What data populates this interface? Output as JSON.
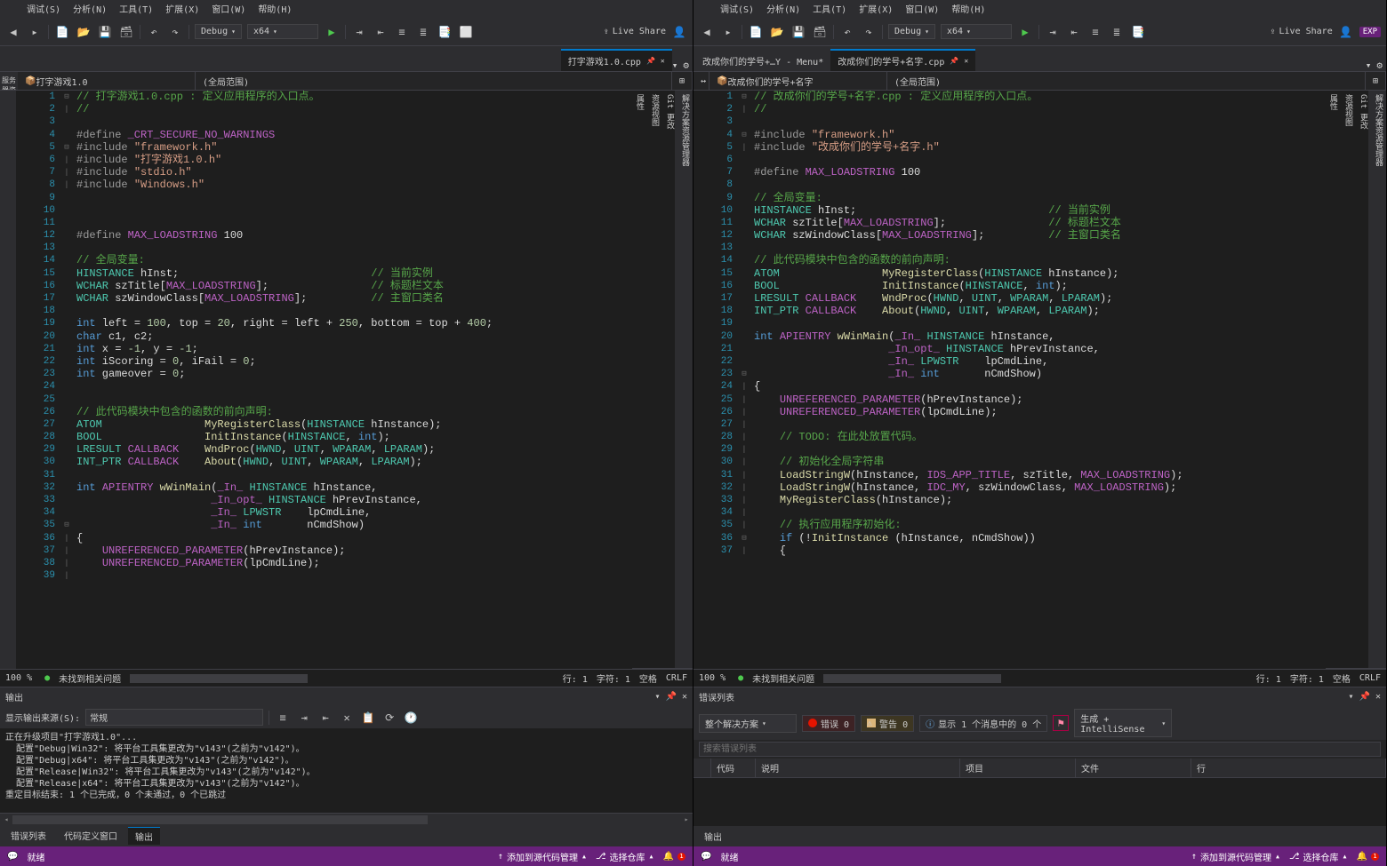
{
  "menu": [
    "调试(S)",
    "分析(N)",
    "工具(T)",
    "扩展(X)",
    "窗口(W)",
    "帮助(H)"
  ],
  "left": {
    "config": "Debug",
    "platform": "x64",
    "liveshare": "Live Share",
    "tab": "打字游戏1.0.cpp",
    "navScope1": "打字游戏1.0",
    "navScope2": "(全局范围)",
    "sideToolLeft": "服务器资源管理器 工具箱",
    "code": [
      {
        "n": 1,
        "f": "⊟",
        "html": "<span class='c-cm'>// 打字游戏1.0.cpp : 定义应用程序的入口点。</span>"
      },
      {
        "n": 2,
        "f": "|",
        "html": "<span class='c-cm'>//</span>"
      },
      {
        "n": 3,
        "f": "",
        "html": ""
      },
      {
        "n": 4,
        "f": "",
        "html": "<span class='c-pp'>#define </span><span class='c-mac'>_CRT_SECURE_NO_WARNINGS</span>"
      },
      {
        "n": 5,
        "f": "⊟",
        "html": "<span class='c-pp'>#include </span><span class='c-str'>\"framework.h\"</span>"
      },
      {
        "n": 6,
        "f": "|",
        "html": "<span class='c-pp'>#include </span><span class='c-str'>\"打字游戏1.0.h\"</span>"
      },
      {
        "n": 7,
        "f": "|",
        "html": "<span class='c-pp'>#include </span><span class='c-str'>\"stdio.h\"</span>"
      },
      {
        "n": 8,
        "f": "|",
        "html": "<span class='c-pp'>#include </span><span class='c-str'>\"Windows.h\"</span>"
      },
      {
        "n": 9,
        "f": "",
        "html": ""
      },
      {
        "n": 10,
        "f": "",
        "html": ""
      },
      {
        "n": 11,
        "f": "",
        "html": ""
      },
      {
        "n": 12,
        "f": "",
        "html": "<span class='c-pp'>#define </span><span class='c-mac'>MAX_LOADSTRING</span><span class='c-id'> 100</span>"
      },
      {
        "n": 13,
        "f": "",
        "html": ""
      },
      {
        "n": 14,
        "f": "",
        "html": "<span class='c-cm'>// 全局变量:</span>"
      },
      {
        "n": 15,
        "f": "",
        "html": "<span class='c-ty'>HINSTANCE</span><span class='c-id'> hInst;                              </span><span class='c-cm'>// 当前实例</span>"
      },
      {
        "n": 16,
        "f": "",
        "html": "<span class='c-ty'>WCHAR</span><span class='c-id'> szTitle[</span><span class='c-mac'>MAX_LOADSTRING</span><span class='c-id'>];                </span><span class='c-cm'>// 标题栏文本</span>"
      },
      {
        "n": 17,
        "f": "",
        "html": "<span class='c-ty'>WCHAR</span><span class='c-id'> szWindowClass[</span><span class='c-mac'>MAX_LOADSTRING</span><span class='c-id'>];          </span><span class='c-cm'>// 主窗口类名</span>"
      },
      {
        "n": 18,
        "f": "",
        "html": ""
      },
      {
        "n": 19,
        "f": "",
        "html": "<span class='c-kw'>int</span><span class='c-id'> left = </span><span class='c-num'>100</span><span class='c-id'>, top = </span><span class='c-num'>20</span><span class='c-id'>, right = left + </span><span class='c-num'>250</span><span class='c-id'>, bottom = top + </span><span class='c-num'>400</span><span class='c-id'>;</span>"
      },
      {
        "n": 20,
        "f": "",
        "html": "<span class='c-kw'>char</span><span class='c-id'> c1, c2;</span>"
      },
      {
        "n": 21,
        "f": "",
        "html": "<span class='c-kw'>int</span><span class='c-id'> x = </span><span class='c-num'>-1</span><span class='c-id'>, y = </span><span class='c-num'>-1</span><span class='c-id'>;</span>"
      },
      {
        "n": 22,
        "f": "",
        "html": "<span class='c-kw'>int</span><span class='c-id'> iScoring = </span><span class='c-num'>0</span><span class='c-id'>, iFail = </span><span class='c-num'>0</span><span class='c-id'>;</span>"
      },
      {
        "n": 23,
        "f": "",
        "html": "<span class='c-kw'>int</span><span class='c-id'> gameover = </span><span class='c-num'>0</span><span class='c-id'>;</span>"
      },
      {
        "n": 24,
        "f": "",
        "html": ""
      },
      {
        "n": 25,
        "f": "",
        "html": ""
      },
      {
        "n": 26,
        "f": "",
        "html": "<span class='c-cm'>// 此代码模块中包含的函数的前向声明:</span>"
      },
      {
        "n": 27,
        "f": "",
        "html": "<span class='c-ty'>ATOM</span><span class='c-id'>                </span><span class='c-fn'>MyRegisterClass</span><span class='c-id'>(</span><span class='c-ty'>HINSTANCE</span><span class='c-id'> hInstance);</span>"
      },
      {
        "n": 28,
        "f": "",
        "html": "<span class='c-ty'>BOOL</span><span class='c-id'>                </span><span class='c-fn'>InitInstance</span><span class='c-id'>(</span><span class='c-ty'>HINSTANCE</span><span class='c-id'>, </span><span class='c-kw'>int</span><span class='c-id'>);</span>"
      },
      {
        "n": 29,
        "f": "",
        "html": "<span class='c-ty'>LRESULT</span><span class='c-id'> </span><span class='c-mac'>CALLBACK</span><span class='c-id'>    </span><span class='c-fn'>WndProc</span><span class='c-id'>(</span><span class='c-ty'>HWND</span><span class='c-id'>, </span><span class='c-ty'>UINT</span><span class='c-id'>, </span><span class='c-ty'>WPARAM</span><span class='c-id'>, </span><span class='c-ty'>LPARAM</span><span class='c-id'>);</span>"
      },
      {
        "n": 30,
        "f": "",
        "html": "<span class='c-ty'>INT_PTR</span><span class='c-id'> </span><span class='c-mac'>CALLBACK</span><span class='c-id'>    </span><span class='c-fn'>About</span><span class='c-id'>(</span><span class='c-ty'>HWND</span><span class='c-id'>, </span><span class='c-ty'>UINT</span><span class='c-id'>, </span><span class='c-ty'>WPARAM</span><span class='c-id'>, </span><span class='c-ty'>LPARAM</span><span class='c-id'>);</span>"
      },
      {
        "n": 31,
        "f": "",
        "html": ""
      },
      {
        "n": 32,
        "f": "",
        "html": "<span class='c-kw'>int</span><span class='c-id'> </span><span class='c-mac'>APIENTRY</span><span class='c-id'> </span><span class='c-fn'>wWinMain</span><span class='c-id'>(</span><span class='c-mac'>_In_</span><span class='c-id'> </span><span class='c-ty'>HINSTANCE</span><span class='c-id'> hInstance,</span>"
      },
      {
        "n": 33,
        "f": "",
        "html": "<span class='c-id'>                     </span><span class='c-mac'>_In_opt_</span><span class='c-id'> </span><span class='c-ty'>HINSTANCE</span><span class='c-id'> hPrevInstance,</span>"
      },
      {
        "n": 34,
        "f": "",
        "html": "<span class='c-id'>                     </span><span class='c-mac'>_In_</span><span class='c-id'> </span><span class='c-ty'>LPWSTR</span><span class='c-id'>    lpCmdLine,</span>"
      },
      {
        "n": 35,
        "f": "⊟",
        "html": "<span class='c-id'>                     </span><span class='c-mac'>_In_</span><span class='c-id'> </span><span class='c-kw'>int</span><span class='c-id'>       nCmdShow)</span>"
      },
      {
        "n": 36,
        "f": "|",
        "html": "<span class='c-id'>{</span>"
      },
      {
        "n": 37,
        "f": "|",
        "html": "<span class='c-id'>    </span><span class='c-mac'>UNREFERENCED_PARAMETER</span><span class='c-id'>(hPrevInstance);</span>"
      },
      {
        "n": 38,
        "f": "|",
        "html": "<span class='c-id'>    </span><span class='c-mac'>UNREFERENCED_PARAMETER</span><span class='c-id'>(lpCmdLine);</span>"
      },
      {
        "n": 39,
        "f": "|",
        "html": ""
      }
    ],
    "zoom": "100 %",
    "noIssues": "未找到相关问题",
    "cursorLine": "行: 1",
    "cursorCol": "字符: 1",
    "insertMode": "空格",
    "crlf": "CRLF",
    "out": {
      "header": "输出",
      "srcLabel": "显示输出来源(S):",
      "srcVal": "常规",
      "lines": [
        "正在升级项目\"打字游戏1.0\"...",
        "  配置\"Debug|Win32\": 将平台工具集更改为\"v143\"(之前为\"v142\")。",
        "  配置\"Debug|x64\": 将平台工具集更改为\"v143\"(之前为\"v142\")。",
        "  配置\"Release|Win32\": 将平台工具集更改为\"v143\"(之前为\"v142\")。",
        "  配置\"Release|x64\": 将平台工具集更改为\"v143\"(之前为\"v142\")。",
        "重定目标结束: 1 个已完成，0 个未通过，0 个已跳过"
      ]
    },
    "bottomTabs": [
      "错误列表",
      "代码定义窗口",
      "输出"
    ],
    "bottomTabActive": 2,
    "status": {
      "ready": "就绪",
      "scm": "添加到源代码管理",
      "repo": "选择仓库",
      "errCount": "1"
    }
  },
  "right": {
    "config": "Debug",
    "platform": "x64",
    "liveshare": "Live Share",
    "exp": "EXP",
    "tab1": "改成你们的学号+…Y - Menu*",
    "tab2": "改成你们的学号+名字.cpp",
    "navScope1": "改成你们的学号+名字",
    "navScope2": "(全局范围)",
    "sidePanels": [
      "解决方案资源管理器",
      "Git 更改",
      "资源视图",
      "属性"
    ],
    "code": [
      {
        "n": 1,
        "f": "⊟",
        "html": "<span class='c-cm'>// 改成你们的学号+名字.cpp : 定义应用程序的入口点。</span>"
      },
      {
        "n": 2,
        "f": "|",
        "html": "<span class='c-cm'>//</span>"
      },
      {
        "n": 3,
        "f": "",
        "html": ""
      },
      {
        "n": 4,
        "f": "⊟",
        "html": "<span class='c-pp'>#include </span><span class='c-str'>\"framework.h\"</span>"
      },
      {
        "n": 5,
        "f": "|",
        "html": "<span class='c-pp'>#include </span><span class='c-str'>\"改成你们的学号+名字.h\"</span>"
      },
      {
        "n": 6,
        "f": "",
        "html": ""
      },
      {
        "n": 7,
        "f": "",
        "html": "<span class='c-pp'>#define </span><span class='c-mac'>MAX_LOADSTRING</span><span class='c-id'> 100</span>"
      },
      {
        "n": 8,
        "f": "",
        "html": ""
      },
      {
        "n": 9,
        "f": "",
        "html": "<span class='c-cm'>// 全局变量:</span>"
      },
      {
        "n": 10,
        "f": "",
        "html": "<span class='c-ty'>HINSTANCE</span><span class='c-id'> hInst;                              </span><span class='c-cm'>// 当前实例</span>"
      },
      {
        "n": 11,
        "f": "",
        "html": "<span class='c-ty'>WCHAR</span><span class='c-id'> szTitle[</span><span class='c-mac'>MAX_LOADSTRING</span><span class='c-id'>];                </span><span class='c-cm'>// 标题栏文本</span>"
      },
      {
        "n": 12,
        "f": "",
        "html": "<span class='c-ty'>WCHAR</span><span class='c-id'> szWindowClass[</span><span class='c-mac'>MAX_LOADSTRING</span><span class='c-id'>];          </span><span class='c-cm'>// 主窗口类名</span>"
      },
      {
        "n": 13,
        "f": "",
        "html": ""
      },
      {
        "n": 14,
        "f": "",
        "html": "<span class='c-cm'>// 此代码模块中包含的函数的前向声明:</span>"
      },
      {
        "n": 15,
        "f": "",
        "html": "<span class='c-ty'>ATOM</span><span class='c-id'>                </span><span class='c-fn'>MyRegisterClass</span><span class='c-id'>(</span><span class='c-ty'>HINSTANCE</span><span class='c-id'> hInstance);</span>"
      },
      {
        "n": 16,
        "f": "",
        "html": "<span class='c-ty'>BOOL</span><span class='c-id'>                </span><span class='c-fn'>InitInstance</span><span class='c-id'>(</span><span class='c-ty'>HINSTANCE</span><span class='c-id'>, </span><span class='c-kw'>int</span><span class='c-id'>);</span>"
      },
      {
        "n": 17,
        "f": "",
        "html": "<span class='c-ty'>LRESULT</span><span class='c-id'> </span><span class='c-mac'>CALLBACK</span><span class='c-id'>    </span><span class='c-fn'>WndProc</span><span class='c-id'>(</span><span class='c-ty'>HWND</span><span class='c-id'>, </span><span class='c-ty'>UINT</span><span class='c-id'>, </span><span class='c-ty'>WPARAM</span><span class='c-id'>, </span><span class='c-ty'>LPARAM</span><span class='c-id'>);</span>"
      },
      {
        "n": 18,
        "f": "",
        "html": "<span class='c-ty'>INT_PTR</span><span class='c-id'> </span><span class='c-mac'>CALLBACK</span><span class='c-id'>    </span><span class='c-fn'>About</span><span class='c-id'>(</span><span class='c-ty'>HWND</span><span class='c-id'>, </span><span class='c-ty'>UINT</span><span class='c-id'>, </span><span class='c-ty'>WPARAM</span><span class='c-id'>, </span><span class='c-ty'>LPARAM</span><span class='c-id'>);</span>"
      },
      {
        "n": 19,
        "f": "",
        "html": ""
      },
      {
        "n": 20,
        "f": "",
        "html": "<span class='c-kw'>int</span><span class='c-id'> </span><span class='c-mac'>APIENTRY</span><span class='c-id'> </span><span class='c-fn'>wWinMain</span><span class='c-id'>(</span><span class='c-mac'>_In_</span><span class='c-id'> </span><span class='c-ty'>HINSTANCE</span><span class='c-id'> hInstance,</span>"
      },
      {
        "n": 21,
        "f": "",
        "html": "<span class='c-id'>                     </span><span class='c-mac'>_In_opt_</span><span class='c-id'> </span><span class='c-ty'>HINSTANCE</span><span class='c-id'> hPrevInstance,</span>"
      },
      {
        "n": 22,
        "f": "",
        "html": "<span class='c-id'>                     </span><span class='c-mac'>_In_</span><span class='c-id'> </span><span class='c-ty'>LPWSTR</span><span class='c-id'>    lpCmdLine,</span>"
      },
      {
        "n": 23,
        "f": "⊟",
        "html": "<span class='c-id'>                     </span><span class='c-mac'>_In_</span><span class='c-id'> </span><span class='c-kw'>int</span><span class='c-id'>       nCmdShow)</span>"
      },
      {
        "n": 24,
        "f": "|",
        "html": "<span class='c-id'>{</span>"
      },
      {
        "n": 25,
        "f": "|",
        "html": "<span class='c-id'>    </span><span class='c-mac'>UNREFERENCED_PARAMETER</span><span class='c-id'>(hPrevInstance);</span>"
      },
      {
        "n": 26,
        "f": "|",
        "html": "<span class='c-id'>    </span><span class='c-mac'>UNREFERENCED_PARAMETER</span><span class='c-id'>(lpCmdLine);</span>"
      },
      {
        "n": 27,
        "f": "|",
        "html": ""
      },
      {
        "n": 28,
        "f": "|",
        "html": "<span class='c-id'>    </span><span class='c-cm'>// TODO: 在此处放置代码。</span>"
      },
      {
        "n": 29,
        "f": "|",
        "html": ""
      },
      {
        "n": 30,
        "f": "|",
        "html": "<span class='c-id'>    </span><span class='c-cm'>// 初始化全局字符串</span>"
      },
      {
        "n": 31,
        "f": "|",
        "html": "<span class='c-id'>    </span><span class='c-fn'>LoadStringW</span><span class='c-id'>(hInstance, </span><span class='c-mac'>IDS_APP_TITLE</span><span class='c-id'>, szTitle, </span><span class='c-mac'>MAX_LOADSTRING</span><span class='c-id'>);</span>"
      },
      {
        "n": 32,
        "f": "|",
        "html": "<span class='c-id'>    </span><span class='c-fn'>LoadStringW</span><span class='c-id'>(hInstance, </span><span class='c-mac'>IDC_MY</span><span class='c-id'>, szWindowClass, </span><span class='c-mac'>MAX_LOADSTRING</span><span class='c-id'>);</span>"
      },
      {
        "n": 33,
        "f": "|",
        "html": "<span class='c-id'>    </span><span class='c-fn'>MyRegisterClass</span><span class='c-id'>(hInstance);</span>"
      },
      {
        "n": 34,
        "f": "|",
        "html": ""
      },
      {
        "n": 35,
        "f": "|",
        "html": "<span class='c-id'>    </span><span class='c-cm'>// 执行应用程序初始化:</span>"
      },
      {
        "n": 36,
        "f": "⊟",
        "html": "<span class='c-id'>    </span><span class='c-kw'>if</span><span class='c-id'> (!</span><span class='c-fn'>InitInstance</span><span class='c-id'> (hInstance, nCmdShow))</span>"
      },
      {
        "n": 37,
        "f": "|",
        "html": "<span class='c-id'>    {</span>"
      }
    ],
    "zoom": "100 %",
    "noIssues": "未找到相关问题",
    "cursorLine": "行: 1",
    "cursorCol": "字符: 1",
    "insertMode": "空格",
    "crlf": "CRLF",
    "errlist": {
      "header": "错误列表",
      "scope": "整个解决方案",
      "errLabel": "错误 0",
      "warnLabel": "警告 0",
      "infoLabel": "显示 1 个消息中的 0 个",
      "filter": "生成 + IntelliSense",
      "searchPlaceholder": "搜索错误列表",
      "cols": [
        "代码",
        "说明",
        "项目",
        "文件",
        "行"
      ]
    },
    "bottomTabs": [
      "输出"
    ],
    "status": {
      "ready": "就绪",
      "scm": "添加到源代码管理",
      "repo": "选择仓库",
      "errCount": "1"
    }
  }
}
